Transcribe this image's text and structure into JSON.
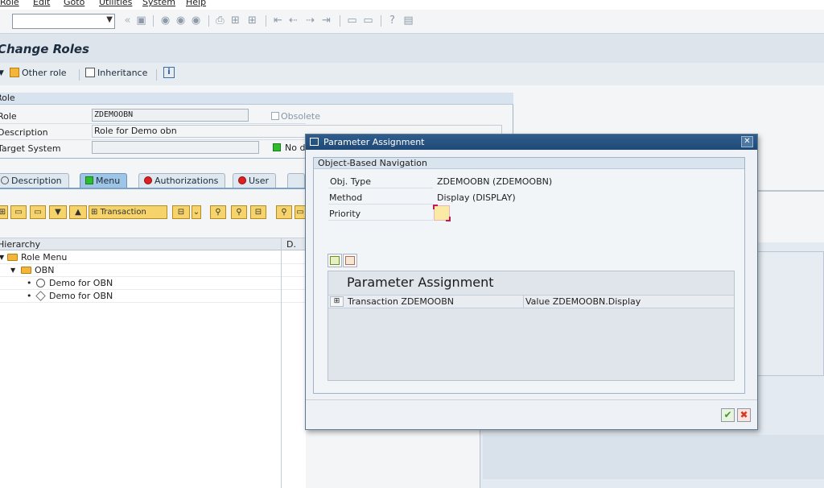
{
  "menu": {
    "items": [
      "Role",
      "Edit",
      "Goto",
      "Utilities",
      "System",
      "Help"
    ]
  },
  "toolbar": {
    "command_field_value": "",
    "icons": [
      "back-icon",
      "save-icon",
      "back-nav-icon",
      "exit-icon",
      "cancel-icon",
      "print-icon",
      "find-icon",
      "find-next-icon",
      "first-page-icon",
      "prev-page-icon",
      "next-page-icon",
      "last-page-icon",
      "create-session-icon",
      "shortcut-icon",
      "help-icon",
      "layout-icon"
    ]
  },
  "page": {
    "title": "Change Roles"
  },
  "app_toolbar": {
    "other_role": "Other role",
    "inheritance": "Inheritance"
  },
  "role_box": {
    "header": "Role",
    "role_label": "Role",
    "role_value": "ZDEMOOBN",
    "obsolete_label": "Obsolete",
    "description_label": "Description",
    "description_value": "Role for Demo obn",
    "target_label": "Target System",
    "target_value": "",
    "no_dest_label": "No d"
  },
  "tabs": [
    {
      "label": "Description",
      "status": "neutral"
    },
    {
      "label": "Menu",
      "status": "green"
    },
    {
      "label": "Authorizations",
      "status": "red"
    },
    {
      "label": "User",
      "status": "red"
    },
    {
      "label": "",
      "status": "neutral"
    }
  ],
  "tree_toolbar": {
    "transaction_label": "Transaction"
  },
  "tree": {
    "col_hierarchy": "Hierarchy",
    "col_d": "D.",
    "rows": [
      {
        "label": "Role Menu",
        "level": 0
      },
      {
        "label": "OBN",
        "level": 1
      },
      {
        "label": "Demo for OBN",
        "level": 2
      },
      {
        "label": "Demo for OBN",
        "level": 2
      }
    ]
  },
  "dialog": {
    "title": "Parameter Assignment",
    "group_header": "Object-Based Navigation",
    "obj_type_label": "Obj. Type",
    "obj_type_value": "ZDEMOOBN (ZDEMOOBN)",
    "method_label": "Method",
    "method_value": "Display (DISPLAY)",
    "priority_label": "Priority",
    "priority_value": "",
    "table_title": "Parameter Assignment",
    "table_rows": [
      {
        "col1": "Transaction ZDEMOOBN",
        "col2": "Value ZDEMOOBN.Display"
      }
    ]
  },
  "colors": {
    "title_bar": "#1f4a77",
    "active_tab": "#9ec4e6",
    "ok_green": "#3e9a2e",
    "cancel_red": "#d23a2a"
  }
}
